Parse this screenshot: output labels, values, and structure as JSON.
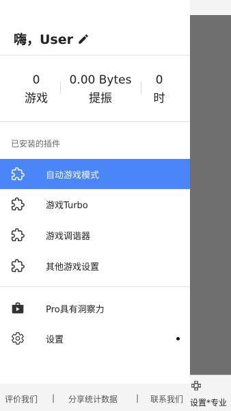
{
  "header": {
    "greeting": "嗨，User"
  },
  "stats": [
    {
      "value": "0",
      "label": "游戏"
    },
    {
      "value": "0.00 Bytes",
      "label": "提振"
    },
    {
      "value": "0",
      "label": "时"
    }
  ],
  "plugins": {
    "section_title": "已安装的插件",
    "items": [
      {
        "label": "自动游戏模式",
        "icon": "puzzle-icon"
      },
      {
        "label": "游戏Turbo",
        "icon": "puzzle-icon"
      },
      {
        "label": "游戏调谐器",
        "icon": "puzzle-icon"
      },
      {
        "label": "其他游戏设置",
        "icon": "puzzle-icon"
      }
    ]
  },
  "menu": {
    "pro_label": "Pro具有洞察力",
    "settings_label": "设置"
  },
  "footer": {
    "rate": "评价我们",
    "share": "分享统计数据",
    "contact": "联系我们",
    "sep": "|"
  },
  "background": {
    "bottom_tab_label": "设置*专业"
  },
  "colors": {
    "accent": "#4a86f7",
    "scrim": "#6f6f6f"
  }
}
